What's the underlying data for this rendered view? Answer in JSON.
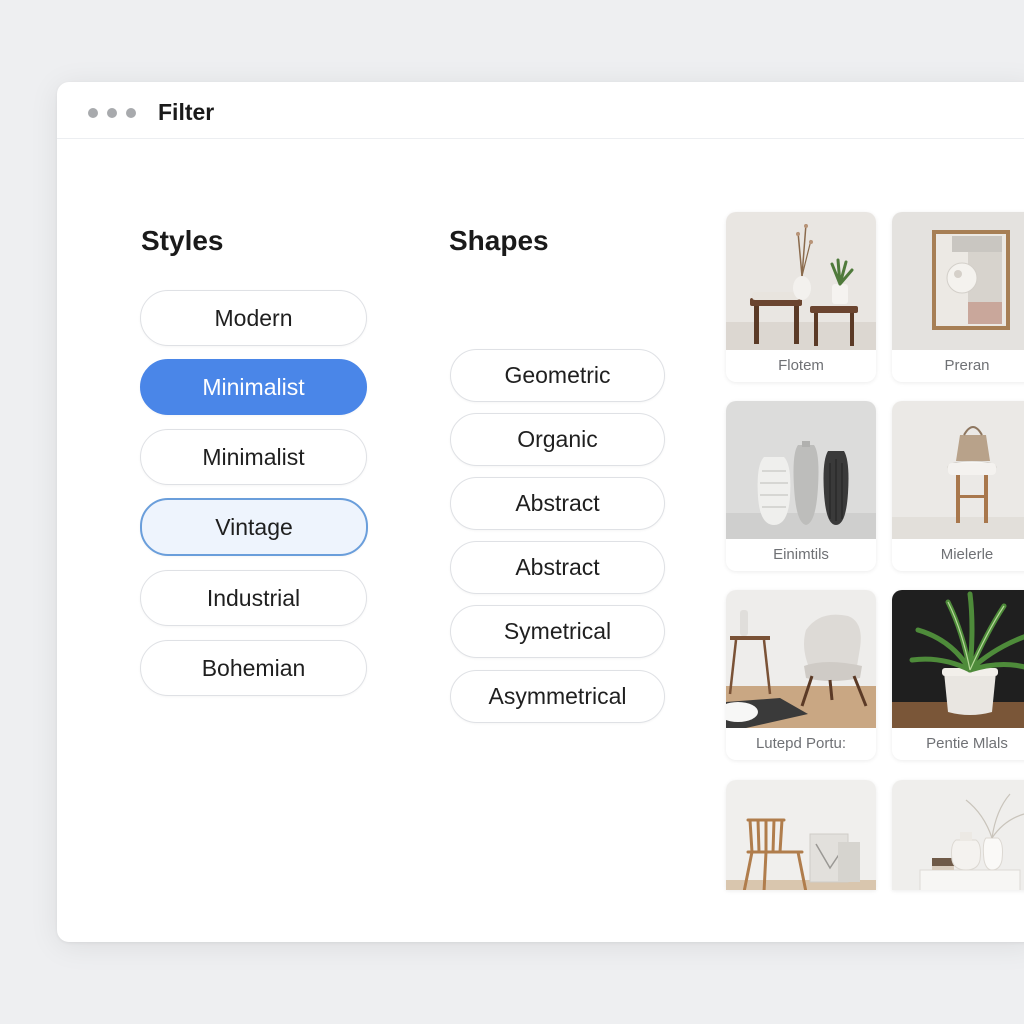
{
  "window": {
    "title": "Filter"
  },
  "styles": {
    "heading": "Styles",
    "options": [
      {
        "label": "Modern",
        "state": "default"
      },
      {
        "label": "Minimalist",
        "state": "selected"
      },
      {
        "label": "Minimalist",
        "state": "default"
      },
      {
        "label": "Vintage",
        "state": "focused"
      },
      {
        "label": "Industrial",
        "state": "default"
      },
      {
        "label": "Bohemian",
        "state": "default"
      }
    ]
  },
  "shapes": {
    "heading": "Shapes",
    "options": [
      {
        "label": "Geometric"
      },
      {
        "label": "Organic"
      },
      {
        "label": "Abstract"
      },
      {
        "label": "Abstract"
      },
      {
        "label": "Symetrical"
      },
      {
        "label": "Asymmetrical"
      }
    ]
  },
  "gallery": {
    "items": [
      {
        "caption": "Flotem",
        "image": "vase-stool-plant-image"
      },
      {
        "caption": "Preran",
        "image": "framed-art-image"
      },
      {
        "caption": "Einimtils",
        "image": "textured-vases-image"
      },
      {
        "caption": "Mielerle",
        "image": "stool-bag-image"
      },
      {
        "caption": "Lutepd Portu:",
        "image": "lounge-chair-image"
      },
      {
        "caption": "Pentie Mlals",
        "image": "potted-plant-image"
      },
      {
        "caption": "",
        "image": "wooden-chair-image"
      },
      {
        "caption": "",
        "image": "ceramic-vases-image"
      }
    ]
  },
  "colors": {
    "accent": "#4a86e8",
    "focus_border": "#6a9edb",
    "focus_fill": "#eef4fd"
  }
}
